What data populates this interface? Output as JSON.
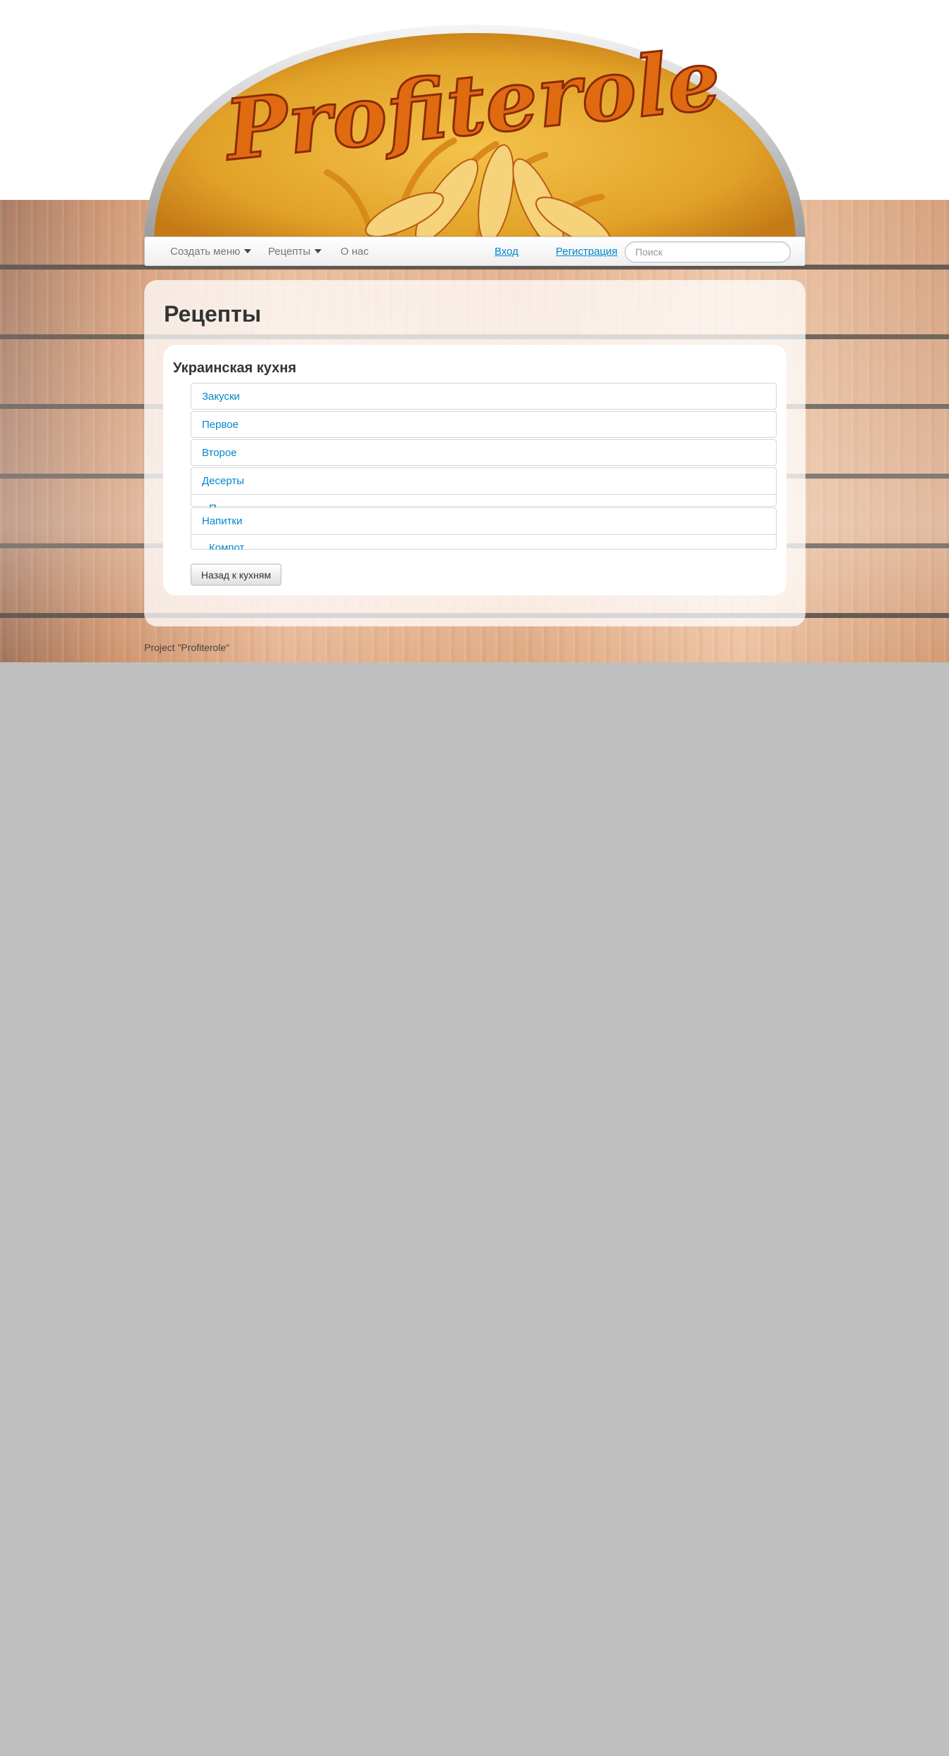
{
  "brand": {
    "logo_text": "Profiterole"
  },
  "nav": {
    "create_menu": "Создать меню",
    "recipes": "Рецепты",
    "about": "О нас",
    "login": "Вход",
    "register": "Регистрация",
    "search_placeholder": "Поиск"
  },
  "main": {
    "title": "Рецепты",
    "cuisine_title": "Украинская кухня",
    "categories": [
      {
        "label": "Закуски"
      },
      {
        "label": "Первое"
      },
      {
        "label": "Второе"
      },
      {
        "label": "Десерты",
        "sub": "П..."
      },
      {
        "label": "Напитки",
        "sub": "Компот"
      }
    ],
    "back_button": "Назад к кухням"
  },
  "footer": {
    "text": "Project \"Profiterole\""
  },
  "colors": {
    "link": "#0088cc",
    "page_bg": "#bfbfbf"
  }
}
